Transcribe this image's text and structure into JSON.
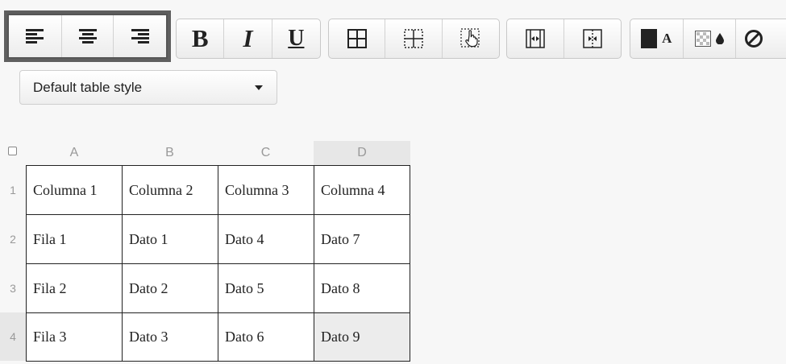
{
  "toolbar": {
    "groups": [
      {
        "name": "alignment",
        "buttons": [
          {
            "icon": "align-left-icon",
            "label": ""
          },
          {
            "icon": "align-center-icon",
            "label": ""
          },
          {
            "icon": "align-right-icon",
            "label": ""
          }
        ]
      },
      {
        "name": "formatting",
        "buttons": [
          {
            "icon": "bold-icon",
            "label": "B"
          },
          {
            "icon": "italic-icon",
            "label": "I"
          },
          {
            "icon": "underline-icon",
            "label": "U"
          }
        ]
      },
      {
        "name": "borders",
        "buttons": [
          {
            "icon": "table-border-icon"
          },
          {
            "icon": "table-border-dashed-icon"
          },
          {
            "icon": "table-hand-icon"
          }
        ]
      },
      {
        "name": "merge",
        "buttons": [
          {
            "icon": "merge-columns-icon"
          },
          {
            "icon": "split-cells-icon"
          }
        ]
      },
      {
        "name": "colors",
        "buttons": [
          {
            "icon": "text-color-icon",
            "label": "A"
          },
          {
            "icon": "background-color-icon"
          },
          {
            "icon": "clear-format-icon"
          }
        ]
      }
    ],
    "colors": {
      "text_color": "#222222",
      "background_swatch": "#cccccc"
    }
  },
  "table_style": {
    "selected": "Default table style"
  },
  "grid": {
    "columns": [
      "A",
      "B",
      "C",
      "D"
    ],
    "rows": [
      "1",
      "2",
      "3",
      "4"
    ],
    "cells": [
      [
        "Columna 1",
        "Columna 2",
        "Columna 3",
        "Columna 4"
      ],
      [
        "Fila 1",
        "Dato 1",
        "Dato 4",
        "Dato 7"
      ],
      [
        "Fila 2",
        "Dato 2",
        "Dato 5",
        "Dato 8"
      ],
      [
        "Fila 3",
        "Dato 3",
        "Dato 6",
        "Dato 9"
      ]
    ],
    "active_cell": "D4"
  }
}
